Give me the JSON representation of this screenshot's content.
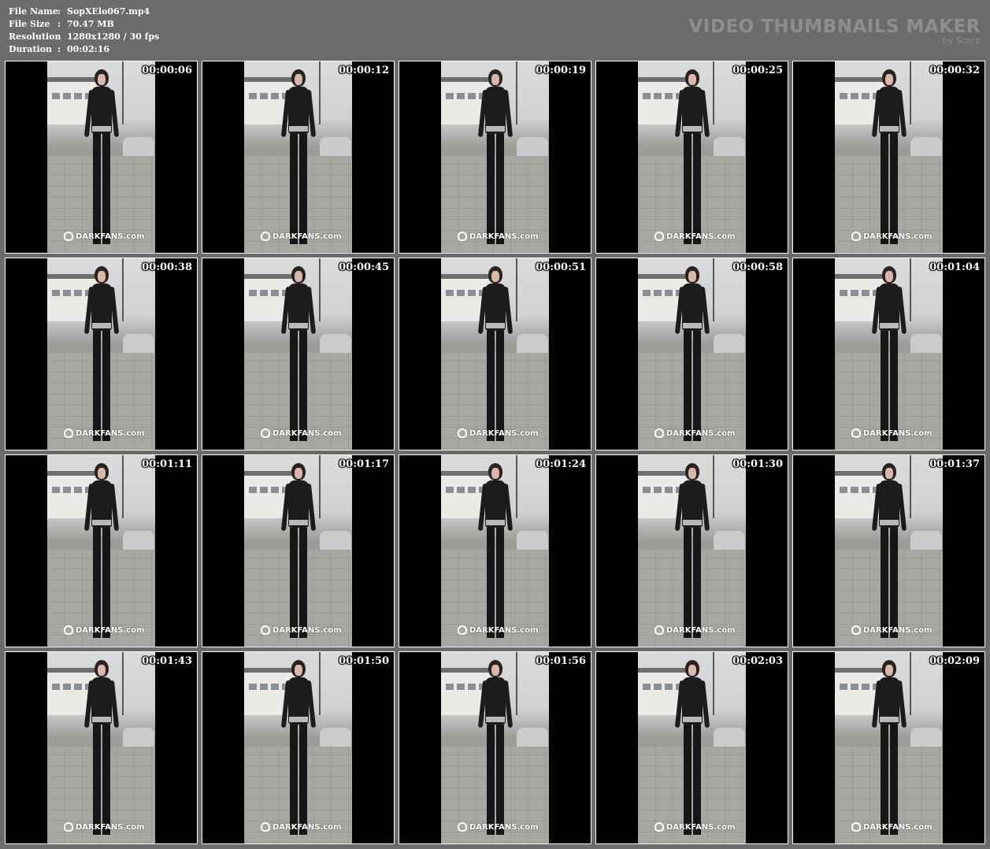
{
  "meta": {
    "rows": [
      {
        "key": "File Name",
        "sep": ":",
        "value": "SopXElo067.mp4"
      },
      {
        "key": "File Size",
        "sep": ":",
        "value": "70.47 MB"
      },
      {
        "key": "Resolution",
        "sep": ":",
        "value": "1280x1280 / 30 fps"
      },
      {
        "key": "Duration",
        "sep": ":",
        "value": "00:02:16"
      }
    ]
  },
  "brand": {
    "title": "VIDEO THUMBNAILS MAKER",
    "byline": "by Scorp"
  },
  "watermark_text": "DARKFANS.com",
  "thumbnails": [
    {
      "timestamp": "00:00:06"
    },
    {
      "timestamp": "00:00:12"
    },
    {
      "timestamp": "00:00:19"
    },
    {
      "timestamp": "00:00:25"
    },
    {
      "timestamp": "00:00:32"
    },
    {
      "timestamp": "00:00:38"
    },
    {
      "timestamp": "00:00:45"
    },
    {
      "timestamp": "00:00:51"
    },
    {
      "timestamp": "00:00:58"
    },
    {
      "timestamp": "00:01:04"
    },
    {
      "timestamp": "00:01:11"
    },
    {
      "timestamp": "00:01:17"
    },
    {
      "timestamp": "00:01:24"
    },
    {
      "timestamp": "00:01:30"
    },
    {
      "timestamp": "00:01:37"
    },
    {
      "timestamp": "00:01:43"
    },
    {
      "timestamp": "00:01:50"
    },
    {
      "timestamp": "00:01:56"
    },
    {
      "timestamp": "00:02:03"
    },
    {
      "timestamp": "00:02:09"
    }
  ],
  "colors": {
    "background": "#6b6b6b",
    "meta_text": "#ffffff",
    "brand_text": "#8e8e8e",
    "frame_border": "#ffffff",
    "letterbox": "#000000"
  }
}
